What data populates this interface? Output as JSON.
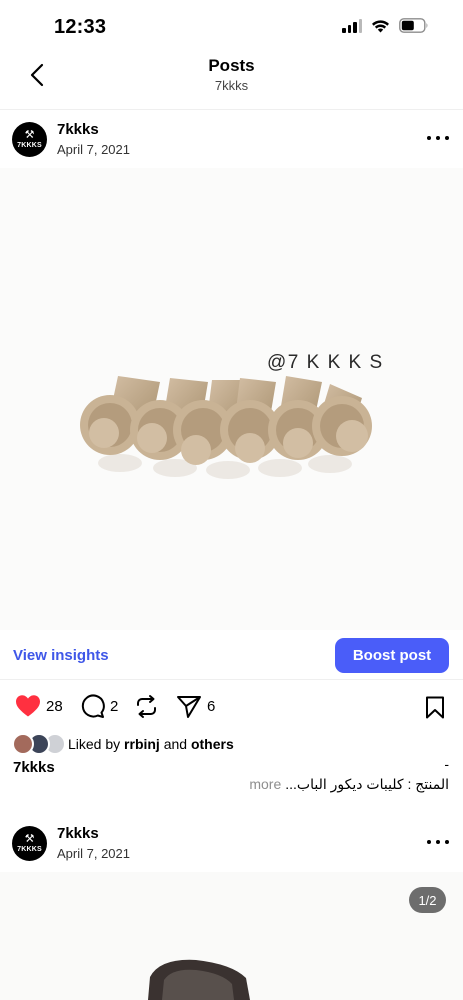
{
  "status_bar": {
    "time": "12:33"
  },
  "nav": {
    "title": "Posts",
    "subtitle": "7kkks"
  },
  "posts": [
    {
      "username": "7kkks",
      "date": "April 7, 2021",
      "avatar_text": "7KKKS",
      "image_watermark": "@7 K K K S",
      "view_insights": "View insights",
      "boost_label": "Boost post",
      "likes": "28",
      "comments": "2",
      "shares": "6",
      "liked_by_prefix": "Liked by ",
      "liked_by_user": "rrbinj",
      "liked_by_and": " and ",
      "liked_by_others": "others",
      "caption_username": "7kkks",
      "caption_dash": "-",
      "caption_text": "المنتج : كليبات ديكور الباب...",
      "caption_more": "more"
    },
    {
      "username": "7kkks",
      "date": "April 7, 2021",
      "avatar_text": "7KKKS",
      "page_indicator": "1/2"
    }
  ],
  "colors": {
    "accent": "#4a5df9",
    "link": "#3f57e8",
    "like_red": "#ff3040",
    "clip_beige": "#c2ab90"
  },
  "icons": {
    "back": "chevron-left-icon",
    "more": "more-horizontal-icon",
    "like": "heart-icon",
    "comment": "comment-icon",
    "repost": "repost-icon",
    "share": "send-icon",
    "save": "bookmark-icon"
  }
}
